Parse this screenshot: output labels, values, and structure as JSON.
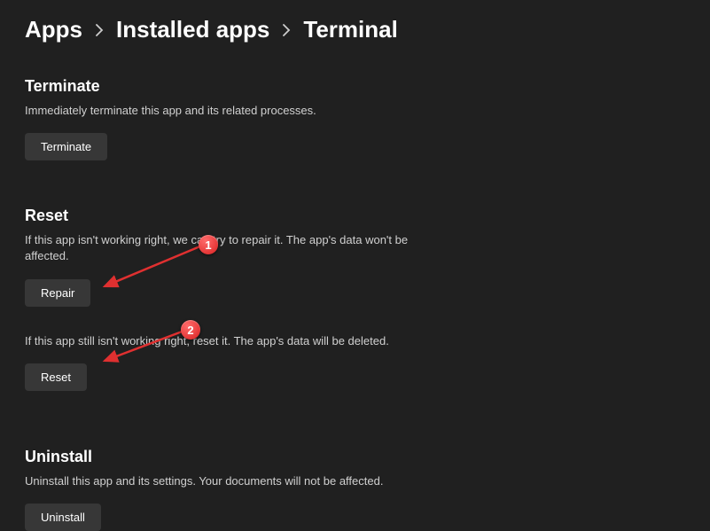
{
  "breadcrumb": {
    "items": [
      "Apps",
      "Installed apps",
      "Terminal"
    ]
  },
  "terminate": {
    "title": "Terminate",
    "desc": "Immediately terminate this app and its related processes.",
    "button": "Terminate"
  },
  "reset": {
    "title": "Reset",
    "repair_desc": "If this app isn't working right, we can try to repair it. The app's data won't be affected.",
    "repair_button": "Repair",
    "reset_desc": "If this app still isn't working right, reset it. The app's data will be deleted.",
    "reset_button": "Reset"
  },
  "uninstall": {
    "title": "Uninstall",
    "desc": "Uninstall this app and its settings. Your documents will not be affected.",
    "button": "Uninstall"
  },
  "annotations": {
    "badge1": "1",
    "badge2": "2"
  }
}
